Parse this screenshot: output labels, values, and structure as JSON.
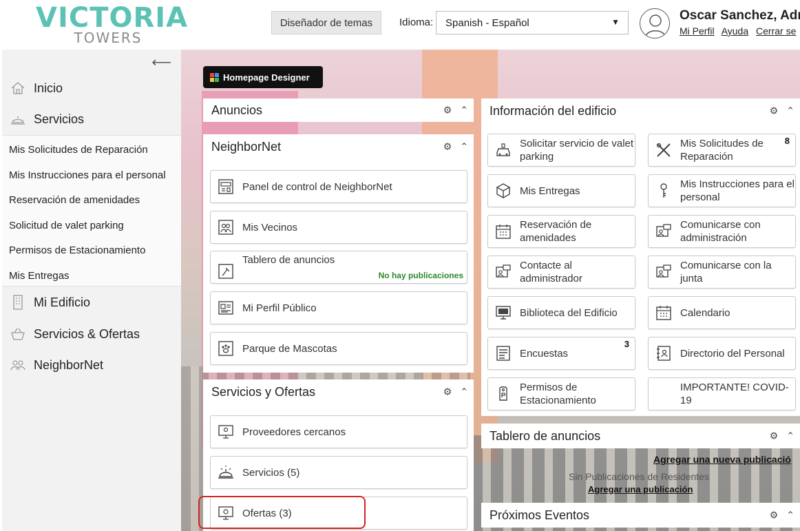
{
  "header": {
    "logo_main": "VICTORIA",
    "logo_sub": "TOWERS",
    "theme_button": "Diseñador de temas",
    "language_label": "Idioma:",
    "language_value": "Spanish - Español",
    "user_name": "Oscar Sanchez, Adm",
    "links": [
      "Mi Perfil",
      "Ayuda",
      "Cerrar se"
    ]
  },
  "sidebar": {
    "main_items": [
      "Inicio",
      "Servicios",
      "Mi Edificio",
      "Servicios & Ofertas",
      "NeighborNet"
    ],
    "sub_items": [
      "Mis Solicitudes de Reparación",
      "Mis Instrucciones para el personal",
      "Reservación de amenidades",
      "Solicitud de valet parking",
      "Permisos de Estacionamiento",
      "Mis Entregas"
    ]
  },
  "homepage_designer": "Homepage Designer",
  "panels": {
    "anuncios": "Anuncios",
    "neighbornet": "NeighborNet",
    "servicios_ofertas": "Servicios y Ofertas",
    "info_edificio": "Información del edificio",
    "tablero": "Tablero de anuncios",
    "eventos": "Próximos Eventos"
  },
  "neighbornet_tiles": [
    "Panel de control de NeighborNet",
    "Mis Vecinos",
    "Tablero de anuncios",
    "Mi Perfil Público",
    "Parque de Mascotas"
  ],
  "no_posts_note": "No hay publicaciones",
  "servicios_tiles": [
    "Proveedores cercanos",
    "Servicios (5)",
    "Ofertas (3)"
  ],
  "info_tiles": [
    {
      "label": "Solicitar servicio de valet parking",
      "badge": ""
    },
    {
      "label": "Mis Solicitudes de Reparación",
      "badge": "8"
    },
    {
      "label": "Mis Entregas",
      "badge": ""
    },
    {
      "label": "Mis Instrucciones para el personal",
      "badge": ""
    },
    {
      "label": "Reservación de amenidades",
      "badge": ""
    },
    {
      "label": "Comunicarse con administración",
      "badge": ""
    },
    {
      "label": "Contacte al administrador",
      "badge": ""
    },
    {
      "label": "Comunicarse con la junta",
      "badge": ""
    },
    {
      "label": "Biblioteca del Edificio",
      "badge": ""
    },
    {
      "label": "Calendario",
      "badge": ""
    },
    {
      "label": "Encuestas",
      "badge": "3"
    },
    {
      "label": "Directorio del Personal",
      "badge": ""
    },
    {
      "label": "Permisos de Estacionamiento",
      "badge": ""
    },
    {
      "label": "IMPORTANTE! COVID-19",
      "badge": ""
    }
  ],
  "tablero": {
    "add_new": "Agregar una nueva publicació",
    "empty": "Sin Publicaciones de Residentes",
    "add": "Agregar una publicación"
  }
}
